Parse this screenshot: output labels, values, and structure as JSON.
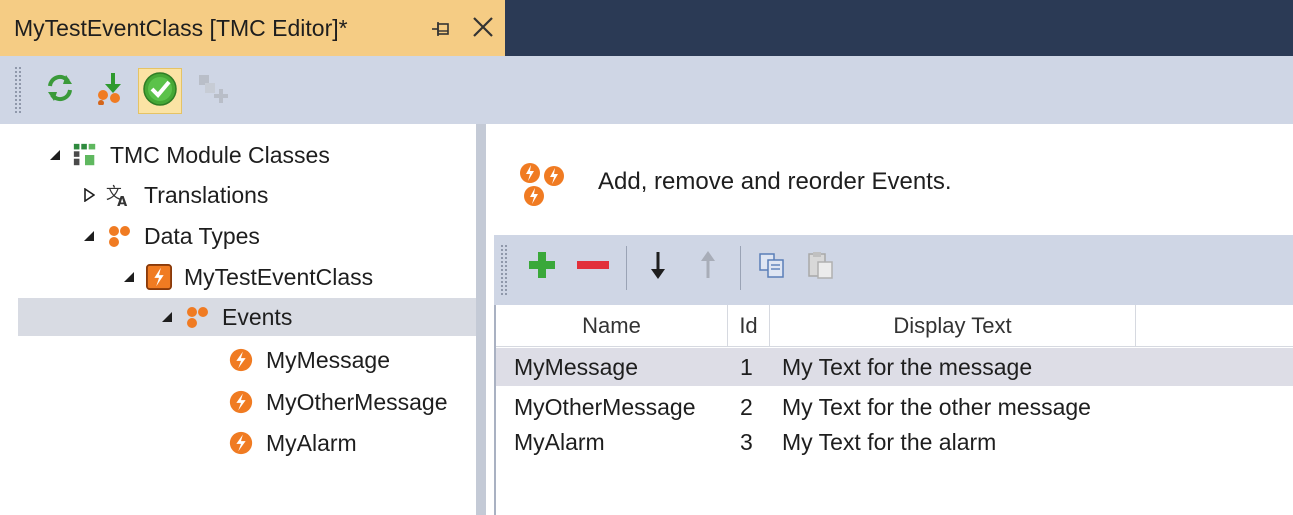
{
  "tab": {
    "title": "MyTestEventClass [TMC Editor]*",
    "pin_icon": "pin-icon",
    "close_icon": "close-icon"
  },
  "toolbar": {
    "buttons": [
      {
        "name": "refresh-icon"
      },
      {
        "name": "download-icon"
      },
      {
        "name": "check-icon",
        "checked": true
      },
      {
        "name": "add-disabled-icon",
        "disabled": true
      }
    ]
  },
  "tree": {
    "nodes": [
      {
        "label": "TMC Module Classes",
        "icon": "module-classes-icon",
        "expanded": true,
        "level": 0
      },
      {
        "label": "Translations",
        "icon": "translations-icon",
        "expanded": false,
        "level": 1
      },
      {
        "label": "Data Types",
        "icon": "data-types-icon",
        "expanded": true,
        "level": 1
      },
      {
        "label": "MyTestEventClass",
        "icon": "event-class-icon",
        "expanded": true,
        "level": 2
      },
      {
        "label": "Events",
        "icon": "events-icon",
        "expanded": true,
        "level": 3,
        "selected": true
      },
      {
        "label": "MyMessage",
        "icon": "event-icon",
        "level": 4
      },
      {
        "label": "MyOtherMessage",
        "icon": "event-icon",
        "level": 4
      },
      {
        "label": "MyAlarm",
        "icon": "event-icon",
        "level": 4
      }
    ]
  },
  "panel": {
    "header_text": "Add, remove and reorder Events.",
    "header_icon": "events-icon"
  },
  "grid_toolbar": {
    "buttons": [
      "add-icon",
      "remove-icon",
      "move-down-icon",
      "move-up-icon",
      "copy-icon",
      "paste-icon"
    ]
  },
  "grid": {
    "columns": [
      "Name",
      "Id",
      "Display Text",
      ""
    ],
    "rows": [
      {
        "name": "MyMessage",
        "id": "1",
        "text": "My Text for the message",
        "selected": true
      },
      {
        "name": "MyOtherMessage",
        "id": "2",
        "text": "My Text for the other message"
      },
      {
        "name": "MyAlarm",
        "id": "3",
        "text": "My Text for the alarm"
      }
    ]
  },
  "colors": {
    "tab_active": "#f5cc84",
    "tab_strip": "#2b3a55",
    "toolbar": "#cfd6e5",
    "selection": "#d8dbe3",
    "event_orange": "#f07b22"
  }
}
